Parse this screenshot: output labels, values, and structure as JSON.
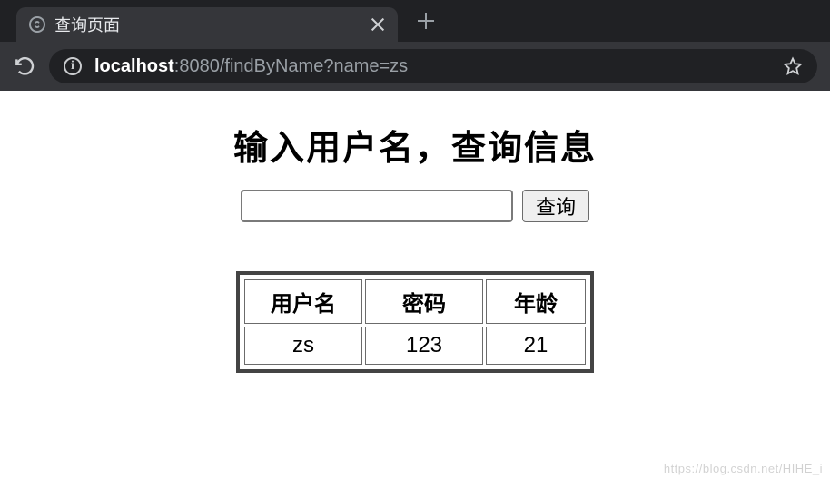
{
  "browser": {
    "tab_title": "查询页面",
    "url_host": "localhost",
    "url_rest": ":8080/findByName?name=zs"
  },
  "page": {
    "heading": "输入用户名，查询信息",
    "search_value": "",
    "submit_label": "查询",
    "table": {
      "headers": [
        "用户名",
        "密码",
        "年龄"
      ],
      "rows": [
        {
          "username": "zs",
          "password": "123",
          "age": "21"
        }
      ]
    }
  },
  "watermark": "https://blog.csdn.net/HIHE_i"
}
